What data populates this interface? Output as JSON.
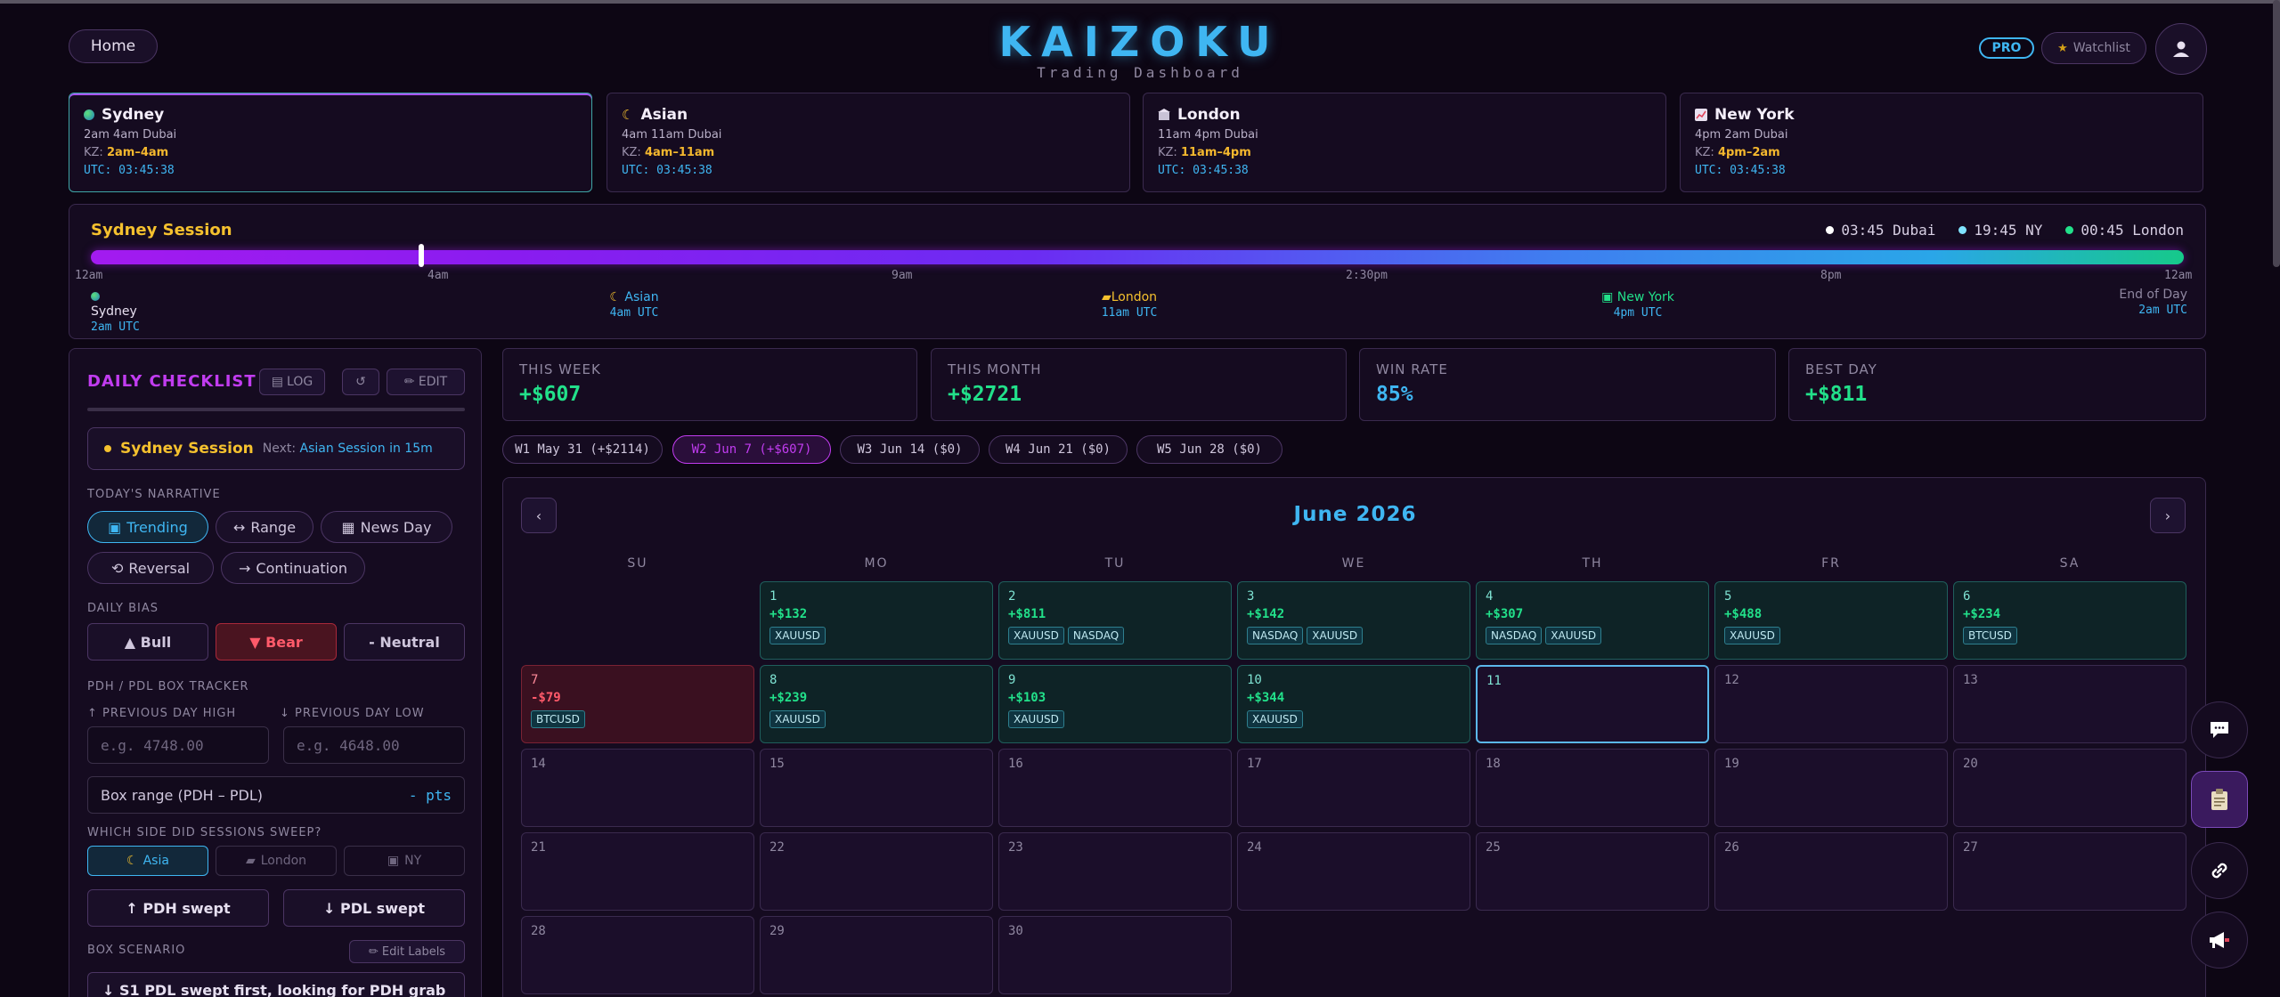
{
  "header": {
    "home_label": "Home",
    "brand_title": "KAIZOKU",
    "brand_subtitle": "Trading Dashboard",
    "pro_label": "PRO",
    "watchlist_label": "Watchlist"
  },
  "sessions": [
    {
      "name": "Sydney",
      "hours": "2am 4am Dubai",
      "kz_label": "KZ:",
      "kz": "2am–4am",
      "utc": "UTC: 03:45:38",
      "icon": "globe-icon"
    },
    {
      "name": "Asian",
      "hours": "4am 11am Dubai",
      "kz_label": "KZ:",
      "kz": "4am–11am",
      "utc": "UTC: 03:45:38",
      "icon": "moon-icon"
    },
    {
      "name": "London",
      "hours": "11am 4pm Dubai",
      "kz_label": "KZ:",
      "kz": "11am–4pm",
      "utc": "UTC: 03:45:38",
      "icon": "building-icon"
    },
    {
      "name": "New York",
      "hours": "4pm 2am Dubai",
      "kz_label": "KZ:",
      "kz": "4pm–2am",
      "utc": "UTC: 03:45:38",
      "icon": "chart-icon"
    }
  ],
  "timeline": {
    "title": "Sydney Session",
    "clocks": [
      {
        "label": "03:45 Dubai",
        "color": "#ffffff"
      },
      {
        "label": "19:45 NY",
        "color": "#7fe3ff"
      },
      {
        "label": "00:45 London",
        "color": "#22e08a"
      }
    ],
    "progress": 0.158,
    "ticks": [
      "12am",
      "4am",
      "9am",
      "2:30pm",
      "8pm",
      "12am"
    ],
    "labels": [
      {
        "name": "Sydney",
        "time": "2am UTC"
      },
      {
        "name": "Asian",
        "time": "4am UTC"
      },
      {
        "name": "London",
        "time": "11am UTC"
      },
      {
        "name": "New York",
        "time": "4pm UTC"
      },
      {
        "name": "End of Day",
        "time": "2am UTC"
      }
    ]
  },
  "checklist": {
    "title": "DAILY CHECKLIST",
    "log_label": "LOG",
    "reset_label": "↺",
    "edit_label": "✏ EDIT",
    "session_name": "Sydney Session",
    "next_label": "Next:",
    "next_value": "Asian Session in 15m",
    "narrative_label": "TODAY'S NARRATIVE",
    "narratives": [
      "Trending",
      "Range",
      "News Day",
      "Reversal",
      "Continuation"
    ],
    "bias_label": "DAILY BIAS",
    "bias_options": [
      "▲ Bull",
      "▼ Bear",
      "- Neutral"
    ],
    "tracker_label": "PDH / PDL BOX TRACKER",
    "pdh_label": "↑ PREVIOUS DAY HIGH",
    "pdl_label": "↓ PREVIOUS DAY LOW",
    "pdh_placeholder": "e.g. 4748.00",
    "pdl_placeholder": "e.g. 4648.00",
    "range_label": "Box range (PDH – PDL)",
    "range_value": "- pts",
    "sweep_label": "WHICH SIDE DID SESSIONS SWEEP?",
    "sweep_options": [
      "Asia",
      "London",
      "NY"
    ],
    "pdh_swept": "↑ PDH swept",
    "pdl_swept": "↓ PDL swept",
    "scenario_label": "BOX SCENARIO",
    "edit_labels": "✏ Edit Labels",
    "scenario_text": "↓ S1 PDL swept first, looking for PDH grab"
  },
  "stats": [
    {
      "label": "THIS WEEK",
      "value": "+$607"
    },
    {
      "label": "THIS MONTH",
      "value": "+$2721"
    },
    {
      "label": "WIN RATE",
      "value": "85%"
    },
    {
      "label": "BEST DAY",
      "value": "+$811"
    }
  ],
  "weeks": [
    "W1 May 31 (+$2114)",
    "W2 Jun 7 (+$607)",
    "W3 Jun 14 ($0)",
    "W4 Jun 21 ($0)",
    "W5 Jun 28 ($0)"
  ],
  "calendar": {
    "title": "June 2026",
    "prev": "‹",
    "next": "›",
    "weekdays": [
      "SU",
      "MO",
      "TU",
      "WE",
      "TH",
      "FR",
      "SA"
    ],
    "days": [
      {
        "d": "1",
        "pnl": "+$132",
        "tags": [
          "XAUUSD"
        ],
        "kind": "win"
      },
      {
        "d": "2",
        "pnl": "+$811",
        "tags": [
          "XAUUSD",
          "NASDAQ"
        ],
        "kind": "win"
      },
      {
        "d": "3",
        "pnl": "+$142",
        "tags": [
          "NASDAQ",
          "XAUUSD"
        ],
        "kind": "win"
      },
      {
        "d": "4",
        "pnl": "+$307",
        "tags": [
          "NASDAQ",
          "XAUUSD"
        ],
        "kind": "win"
      },
      {
        "d": "5",
        "pnl": "+$488",
        "tags": [
          "XAUUSD"
        ],
        "kind": "win"
      },
      {
        "d": "6",
        "pnl": "+$234",
        "tags": [
          "BTCUSD"
        ],
        "kind": "win"
      },
      {
        "d": "7",
        "pnl": "-$79",
        "tags": [
          "BTCUSD"
        ],
        "kind": "loss"
      },
      {
        "d": "8",
        "pnl": "+$239",
        "tags": [
          "XAUUSD"
        ],
        "kind": "win"
      },
      {
        "d": "9",
        "pnl": "+$103",
        "tags": [
          "XAUUSD"
        ],
        "kind": "win"
      },
      {
        "d": "10",
        "pnl": "+$344",
        "tags": [
          "XAUUSD"
        ],
        "kind": "win"
      },
      {
        "d": "11",
        "pnl": "",
        "tags": [],
        "kind": "today"
      },
      {
        "d": "12",
        "pnl": "",
        "tags": [],
        "kind": "empty"
      },
      {
        "d": "13",
        "pnl": "",
        "tags": [],
        "kind": "empty"
      },
      {
        "d": "14",
        "pnl": "",
        "tags": [],
        "kind": "empty"
      },
      {
        "d": "15",
        "pnl": "",
        "tags": [],
        "kind": "empty"
      },
      {
        "d": "16",
        "pnl": "",
        "tags": [],
        "kind": "empty"
      },
      {
        "d": "17",
        "pnl": "",
        "tags": [],
        "kind": "empty"
      },
      {
        "d": "18",
        "pnl": "",
        "tags": [],
        "kind": "empty"
      },
      {
        "d": "19",
        "pnl": "",
        "tags": [],
        "kind": "empty"
      },
      {
        "d": "20",
        "pnl": "",
        "tags": [],
        "kind": "empty"
      },
      {
        "d": "21",
        "pnl": "",
        "tags": [],
        "kind": "empty"
      },
      {
        "d": "22",
        "pnl": "",
        "tags": [],
        "kind": "empty"
      },
      {
        "d": "23",
        "pnl": "",
        "tags": [],
        "kind": "empty"
      },
      {
        "d": "24",
        "pnl": "",
        "tags": [],
        "kind": "empty"
      },
      {
        "d": "25",
        "pnl": "",
        "tags": [],
        "kind": "empty"
      },
      {
        "d": "26",
        "pnl": "",
        "tags": [],
        "kind": "empty"
      },
      {
        "d": "27",
        "pnl": "",
        "tags": [],
        "kind": "empty"
      },
      {
        "d": "28",
        "pnl": "",
        "tags": [],
        "kind": "empty"
      },
      {
        "d": "29",
        "pnl": "",
        "tags": [],
        "kind": "empty"
      },
      {
        "d": "30",
        "pnl": "",
        "tags": [],
        "kind": "empty"
      }
    ]
  },
  "side_tools": [
    "chat-icon",
    "clipboard-icon",
    "link-icon",
    "megaphone-icon"
  ]
}
